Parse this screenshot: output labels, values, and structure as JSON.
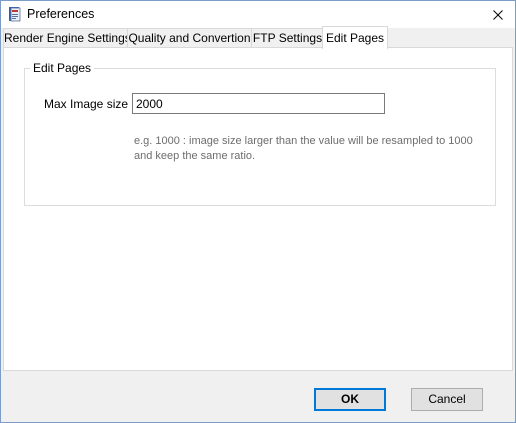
{
  "window": {
    "title": "Preferences"
  },
  "tabs": [
    {
      "label": "Render Engine Settings",
      "active": false
    },
    {
      "label": "Quality and Convertion",
      "active": false
    },
    {
      "label": "FTP Settings",
      "active": false
    },
    {
      "label": "Edit Pages",
      "active": true
    }
  ],
  "edit_pages": {
    "group_title": "Edit Pages",
    "max_image_size": {
      "label": "Max Image size",
      "value": "2000"
    },
    "hint": "e.g. 1000 : image size larger than the value will be resampled to 1000 and keep the same ratio."
  },
  "buttons": {
    "ok": "OK",
    "cancel": "Cancel"
  },
  "colors": {
    "default_button_border": "#0078d7",
    "window_border": "#7a9cc6"
  },
  "icons": {
    "app": "preferences-app-icon",
    "close": "close-icon"
  }
}
